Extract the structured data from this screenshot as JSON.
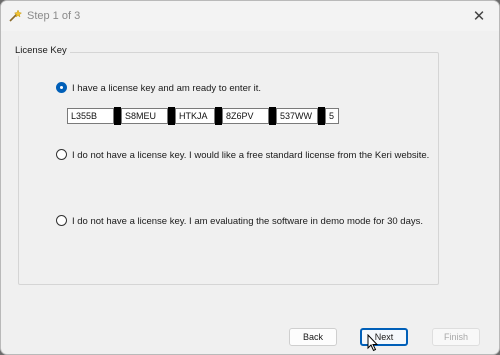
{
  "window": {
    "title": "Step 1 of 3",
    "close_glyph": "✕"
  },
  "group": {
    "legend": "License Key"
  },
  "options": [
    {
      "label": "I have a license key and am ready to enter it.",
      "checked": true
    },
    {
      "label": "I do not have a license key.  I would like a free standard license from the Keri website.",
      "checked": false
    },
    {
      "label": "I do not have a license key.  I am evaluating the software in demo mode for 30 days.",
      "checked": false
    }
  ],
  "license_key": {
    "segments": [
      "L355B",
      "S8MEU",
      "HTKJA",
      "8Z6PV",
      "537WW",
      "5"
    ]
  },
  "buttons": {
    "back": "Back",
    "next": "Next",
    "finish": "Finish",
    "finish_enabled": false
  },
  "colors": {
    "accent": "#005fb8",
    "separator": "#000000"
  },
  "icons": {
    "app": "wizard-wand-icon",
    "cursor": "mouse-pointer-icon"
  }
}
